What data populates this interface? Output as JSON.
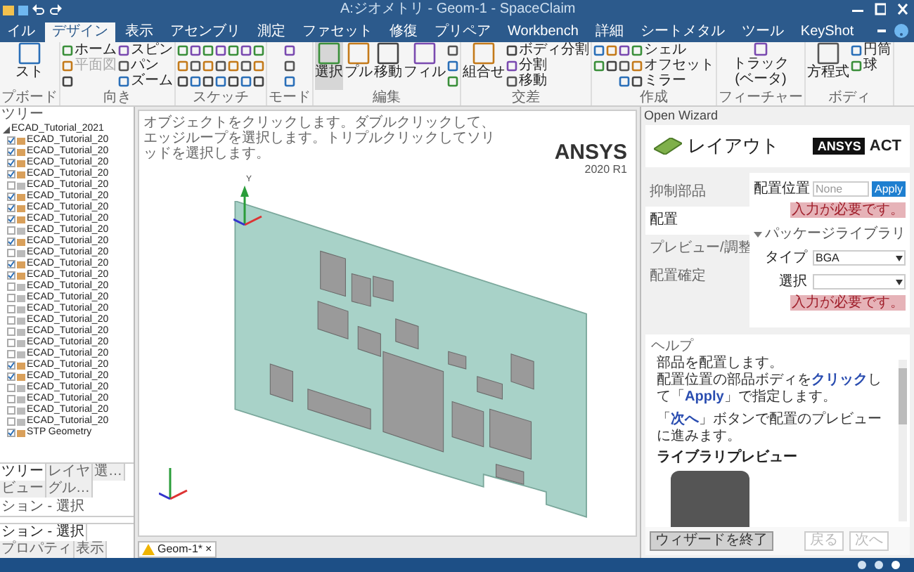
{
  "window": {
    "title": "A:ジオメトリ - Geom-1 - SpaceClaim"
  },
  "tabs": [
    {
      "label": "イル",
      "selected": false
    },
    {
      "label": "デザイン",
      "selected": true
    },
    {
      "label": "表示",
      "selected": false
    },
    {
      "label": "アセンブリ",
      "selected": false
    },
    {
      "label": "測定",
      "selected": false
    },
    {
      "label": "ファセット",
      "selected": false
    },
    {
      "label": "修復",
      "selected": false
    },
    {
      "label": "プリペア",
      "selected": false
    },
    {
      "label": "Workbench",
      "selected": false
    },
    {
      "label": "詳細",
      "selected": false
    },
    {
      "label": "シートメタル",
      "selected": false
    },
    {
      "label": "ツール",
      "selected": false
    },
    {
      "label": "KeyShot",
      "selected": false
    }
  ],
  "ribbon": [
    {
      "label": "プボード",
      "columns": [
        [
          {
            "kind": "large",
            "label": "スト"
          }
        ]
      ]
    },
    {
      "label": "向き",
      "columns": [
        [
          {
            "kind": "small",
            "label": "ホーム"
          },
          {
            "kind": "small",
            "label": "平面図",
            "disabled": true
          },
          {
            "kind": "icon"
          }
        ],
        [
          {
            "kind": "small",
            "label": "スピン"
          },
          {
            "kind": "small",
            "label": "パン"
          },
          {
            "kind": "small",
            "label": "ズーム"
          }
        ]
      ]
    },
    {
      "label": "スケッチ",
      "columns": [
        [
          {
            "kind": "icon"
          },
          {
            "kind": "icon"
          },
          {
            "kind": "icon"
          }
        ],
        [
          {
            "kind": "icon"
          },
          {
            "kind": "icon"
          },
          {
            "kind": "icon"
          }
        ],
        [
          {
            "kind": "icon"
          },
          {
            "kind": "icon"
          },
          {
            "kind": "icon"
          }
        ],
        [
          {
            "kind": "icon"
          },
          {
            "kind": "icon"
          },
          {
            "kind": "icon"
          }
        ],
        [
          {
            "kind": "icon"
          },
          {
            "kind": "icon"
          },
          {
            "kind": "icon"
          }
        ],
        [
          {
            "kind": "icon"
          },
          {
            "kind": "icon"
          },
          {
            "kind": "icon"
          }
        ],
        [
          {
            "kind": "icon"
          },
          {
            "kind": "icon"
          },
          {
            "kind": "icon"
          }
        ]
      ]
    },
    {
      "label": "モード",
      "columns": [
        [
          {
            "kind": "icon"
          },
          {
            "kind": "icon"
          },
          {
            "kind": "icon"
          }
        ]
      ]
    },
    {
      "label": "編集",
      "columns": [
        [
          {
            "kind": "large",
            "label": "選択",
            "selected": true
          }
        ],
        [
          {
            "kind": "large",
            "label": "プル"
          }
        ],
        [
          {
            "kind": "large",
            "label": "移動"
          }
        ],
        [
          {
            "kind": "large",
            "label": "フィル"
          }
        ],
        [
          {
            "kind": "icon"
          },
          {
            "kind": "icon"
          },
          {
            "kind": "icon"
          }
        ]
      ]
    },
    {
      "label": "交差",
      "columns": [
        [
          {
            "kind": "large",
            "label": "組合せ"
          }
        ],
        [
          {
            "kind": "small",
            "label": "ボディ分割"
          },
          {
            "kind": "small",
            "label": "分割"
          },
          {
            "kind": "small",
            "label": "移動"
          }
        ]
      ]
    },
    {
      "label": "作成",
      "columns": [
        [
          {
            "kind": "icon"
          },
          {
            "kind": "icon"
          }
        ],
        [
          {
            "kind": "icon"
          },
          {
            "kind": "icon"
          }
        ],
        [
          {
            "kind": "icon"
          },
          {
            "kind": "icon"
          },
          {
            "kind": "icon"
          }
        ],
        [
          {
            "kind": "small",
            "label": "シェル"
          },
          {
            "kind": "small",
            "label": "オフセット"
          },
          {
            "kind": "small",
            "label": "ミラー"
          }
        ]
      ]
    },
    {
      "label": "フィーチャー",
      "columns": [
        [
          {
            "kind": "large",
            "label": "トラック(ベータ)"
          }
        ]
      ]
    },
    {
      "label": "ボディ",
      "columns": [
        [
          {
            "kind": "large",
            "label": "方程式"
          }
        ],
        [
          {
            "kind": "small",
            "label": "円筒"
          },
          {
            "kind": "small",
            "label": "球"
          }
        ]
      ]
    }
  ],
  "tree": {
    "title": "ツリー",
    "root": {
      "label": "ECAD_Tutorial_2021",
      "expanded": true,
      "children": [
        {
          "label": "ECAD_Tutorial_20",
          "checked": true
        },
        {
          "label": "ECAD_Tutorial_20",
          "checked": true
        },
        {
          "label": "ECAD_Tutorial_20",
          "checked": true
        },
        {
          "label": "ECAD_Tutorial_20",
          "checked": true
        },
        {
          "label": "ECAD_Tutorial_20",
          "checked": false
        },
        {
          "label": "ECAD_Tutorial_20",
          "checked": true
        },
        {
          "label": "ECAD_Tutorial_20",
          "checked": true
        },
        {
          "label": "ECAD_Tutorial_20",
          "checked": true
        },
        {
          "label": "ECAD_Tutorial_20",
          "checked": false
        },
        {
          "label": "ECAD_Tutorial_20",
          "checked": true
        },
        {
          "label": "ECAD_Tutorial_20",
          "checked": false
        },
        {
          "label": "ECAD_Tutorial_20",
          "checked": true
        },
        {
          "label": "ECAD_Tutorial_20",
          "checked": true
        },
        {
          "label": "ECAD_Tutorial_20",
          "checked": false
        },
        {
          "label": "ECAD_Tutorial_20",
          "checked": false
        },
        {
          "label": "ECAD_Tutorial_20",
          "checked": false
        },
        {
          "label": "ECAD_Tutorial_20",
          "checked": false
        },
        {
          "label": "ECAD_Tutorial_20",
          "checked": false
        },
        {
          "label": "ECAD_Tutorial_20",
          "checked": false
        },
        {
          "label": "ECAD_Tutorial_20",
          "checked": false
        },
        {
          "label": "ECAD_Tutorial_20",
          "checked": true
        },
        {
          "label": "ECAD_Tutorial_20",
          "checked": true
        },
        {
          "label": "ECAD_Tutorial_20",
          "checked": false
        },
        {
          "label": "ECAD_Tutorial_20",
          "checked": false
        },
        {
          "label": "ECAD_Tutorial_20",
          "checked": false
        },
        {
          "label": "ECAD_Tutorial_20",
          "checked": false
        },
        {
          "label": "STP Geometry",
          "checked": true
        }
      ]
    }
  },
  "panel_tabs": [
    {
      "label": "ツリー",
      "selected": true
    },
    {
      "label": "レイヤ",
      "selected": false
    },
    {
      "label": "選…",
      "selected": false
    },
    {
      "label": "ビュー",
      "selected": false
    },
    {
      "label": "グル…",
      "selected": false
    }
  ],
  "options_header": "ション - 選択",
  "bottom_tabs": [
    {
      "label": "ション - 選択",
      "selected": true
    },
    {
      "label": "プロパティ",
      "selected": false
    },
    {
      "label": "表示",
      "selected": false
    }
  ],
  "viewport": {
    "hint": "オブジェクトをクリックします。ダブルクリックして、エッジループを選択します。トリプルクリックしてソリッドを選択します。",
    "logo": "ANSYS",
    "version": "2020 R1",
    "triad_label": "Y",
    "doc_tab": "Geom-1*",
    "doc_tab_close": "×"
  },
  "wizard": {
    "title": "Open Wizard",
    "heading": "レイアウト",
    "logo": "ANSYS",
    "logo_suffix": "ACT",
    "steps": [
      {
        "label": "抑制部品",
        "selected": false
      },
      {
        "label": "配置",
        "selected": true
      },
      {
        "label": "プレビュー/調整",
        "selected": false
      },
      {
        "label": "配置確定",
        "selected": false
      }
    ],
    "placement": {
      "label": "配置位置",
      "placeholder": "None",
      "button": "Apply",
      "error": "入力が必要です。"
    },
    "section": {
      "label": "パッケージライブラリ",
      "expanded": true
    },
    "type": {
      "label": "タイプ",
      "value": "BGA"
    },
    "select": {
      "label": "選択",
      "error": "入力が必要です。"
    },
    "help_title": "ヘルプ",
    "help": [
      "部品を配置します。",
      "配置位置の部品ボディを**クリック**して「**Apply**」で指定します。",
      "「**次へ**」ボタンで配置のプレビューに進みます。"
    ],
    "preview_title": "ライブラリプレビュー",
    "buttons": [
      {
        "label": "ウィザードを終了",
        "disabled": false
      },
      {
        "label": "戻る",
        "disabled": true
      },
      {
        "label": "次へ",
        "disabled": true
      }
    ]
  }
}
